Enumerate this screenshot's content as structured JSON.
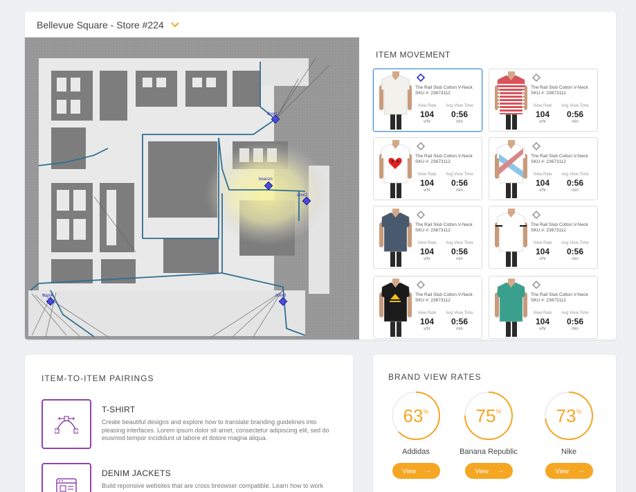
{
  "store": {
    "title": "Bellevue Square - Store #224"
  },
  "map": {
    "doors": [
      "door1",
      "door2",
      "door3",
      "door4"
    ],
    "beacon": "beacon"
  },
  "movement": {
    "title": "ITEM MOVEMENT",
    "items": [
      {
        "name": "The Rail Slub Cotton V-Neck",
        "sku": "SKU #: 23673112",
        "rate_label": "View Rate",
        "rate": "104",
        "rate_unit": "v/hr",
        "time_label": "Avg View Time",
        "time": "0:56",
        "time_unit": "min",
        "shirt": "#f3f1ec",
        "accent": ""
      },
      {
        "name": "The Rail Slub Cotton V-Neck",
        "sku": "SKU #: 23673112",
        "rate_label": "View Rate",
        "rate": "104",
        "rate_unit": "v/hr",
        "time_label": "Avg View Time",
        "time": "0:56",
        "time_unit": "min",
        "shirt": "#d9535a",
        "accent": "stripes"
      },
      {
        "name": "The Rail Slub Cotton V-Neck",
        "sku": "SKU #: 23673112",
        "rate_label": "View Rate",
        "rate": "104",
        "rate_unit": "v/hr",
        "time_label": "Avg View Time",
        "time": "0:56",
        "time_unit": "min",
        "shirt": "#ffffff",
        "accent": "heart"
      },
      {
        "name": "The Rail Slub Cotton V-Neck",
        "sku": "SKU #: 23673112",
        "rate_label": "View Rate",
        "rate": "104",
        "rate_unit": "v/hr",
        "time_label": "Avg View Time",
        "time": "0:56",
        "time_unit": "min",
        "shirt": "#ffffff",
        "accent": "pattern"
      },
      {
        "name": "The Rail Slub Cotton V-Neck",
        "sku": "SKU #: 23673112",
        "rate_label": "View Rate",
        "rate": "104",
        "rate_unit": "v/hr",
        "time_label": "Avg View Time",
        "time": "0:56",
        "time_unit": "min",
        "shirt": "#4a5a6e",
        "accent": ""
      },
      {
        "name": "The Rail Slub Cotton V-Neck",
        "sku": "SKU #: 23673112",
        "rate_label": "View Rate",
        "rate": "104",
        "rate_unit": "v/hr",
        "time_label": "Avg View Time",
        "time": "0:56",
        "time_unit": "min",
        "shirt": "#ffffff",
        "accent": "trim"
      },
      {
        "name": "The Rail Slub Cotton V-Neck",
        "sku": "SKU #: 23673112",
        "rate_label": "View Rate",
        "rate": "104",
        "rate_unit": "v/hr",
        "time_label": "Avg View Time",
        "time": "0:56",
        "time_unit": "min",
        "shirt": "#1b1b1b",
        "accent": "logo"
      },
      {
        "name": "The Rail Slub Cotton V-Neck",
        "sku": "SKU #: 23673112",
        "rate_label": "View Rate",
        "rate": "104",
        "rate_unit": "v/hr",
        "time_label": "Avg View Time",
        "time": "0:56",
        "time_unit": "min",
        "shirt": "#3aa08d",
        "accent": ""
      }
    ]
  },
  "pairings": {
    "title": "ITEM-TO-ITEM PAIRINGS",
    "items": [
      {
        "title": "T-SHIRT",
        "desc": "Create beautiful designs and explore how to translate branding guidelines into pleasing interfaces. Lorem ipsum dolor sit amet, consectetur adipiscing elit, sed do eiusmod tempor incididunt ut labore et dolore magna aliqua.",
        "icon": "vector-pen-icon"
      },
      {
        "title": "DENIM JACKETS",
        "desc": "Build reponsive websites that are cross breowser compatible. Learn how to work",
        "icon": "browser-window-icon"
      }
    ]
  },
  "brands": {
    "title": "BRAND VIEW RATES",
    "items": [
      {
        "pct": "63",
        "pct_value": 63,
        "name": "Addidas",
        "button": "View"
      },
      {
        "pct": "75",
        "pct_value": 75,
        "name": "Banana Republic",
        "button": "View"
      },
      {
        "pct": "73",
        "pct_value": 73,
        "name": "Nike",
        "button": "View"
      }
    ],
    "percent_sign": "%"
  },
  "colors": {
    "accent": "#f5a623",
    "purple": "#8e44ad",
    "selected": "#4a90d9",
    "path": "#2f6f8f"
  }
}
